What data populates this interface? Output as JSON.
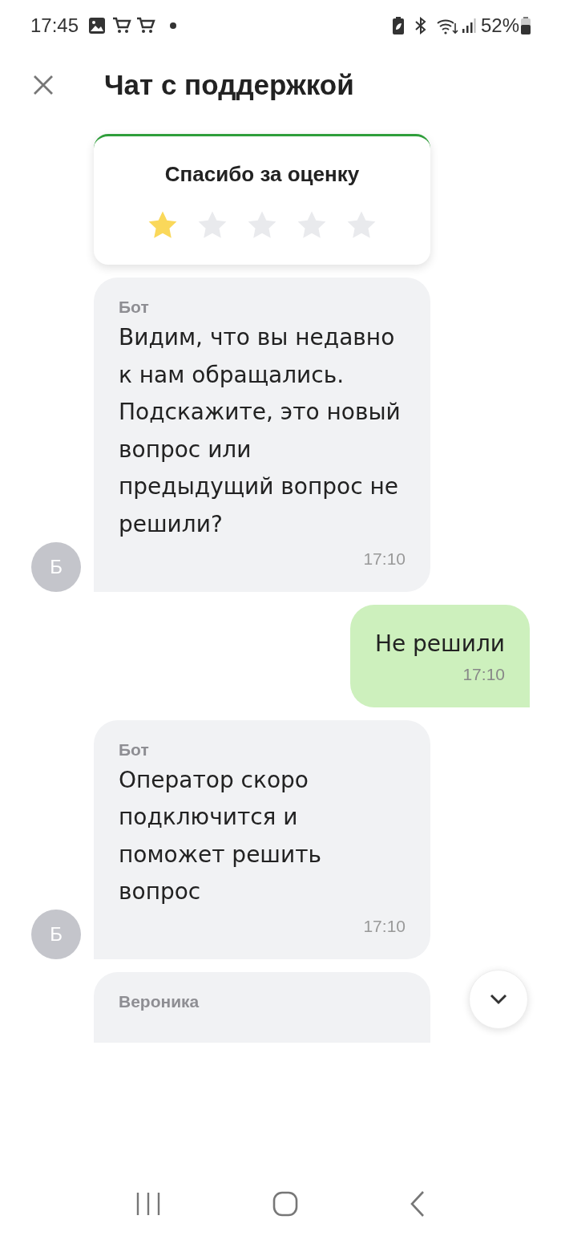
{
  "status_bar": {
    "time": "17:45",
    "battery": "52%"
  },
  "header": {
    "title": "Чат с поддержкой"
  },
  "rating_card": {
    "title": "Спасибо за оценку",
    "stars": 1
  },
  "messages": [
    {
      "kind": "incoming",
      "sender": "Бот",
      "text": "Видим, что вы недавно к нам обращались. Подскажите, это новый вопрос или предыдущий вопрос не решили?",
      "time": "17:10",
      "avatar": "Б"
    },
    {
      "kind": "outgoing",
      "text": "Не решили",
      "time": "17:10"
    },
    {
      "kind": "incoming",
      "sender": "Бот",
      "text": "Оператор скоро подключится и поможет решить вопрос",
      "time": "17:10",
      "avatar": "Б"
    },
    {
      "kind": "incoming",
      "sender": "Вероника"
    }
  ]
}
